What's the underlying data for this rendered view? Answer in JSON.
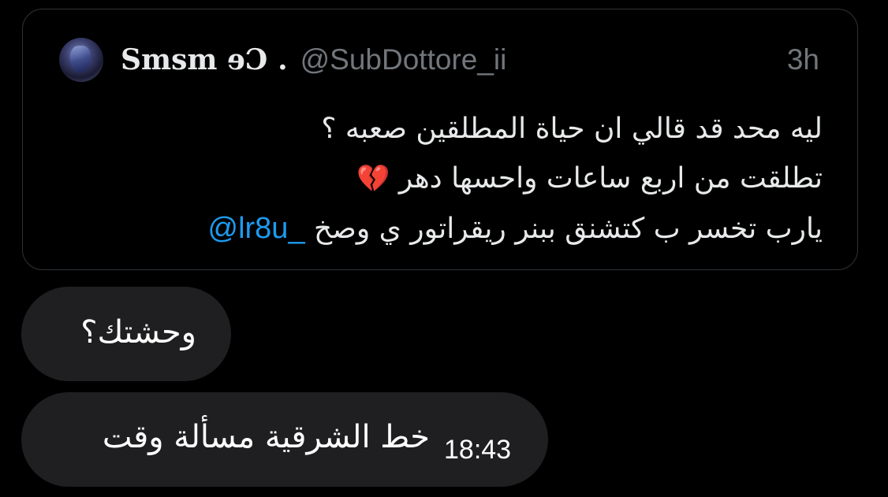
{
  "quoted_tweet": {
    "display_name": "Smsm ɘƆ .",
    "handle": "@SubDottore_ii",
    "time_ago": "3h",
    "lines": [
      "ليه محد قد قالي ان حياة المطلقين صعبه ؟",
      "تطلقت من اربع ساعات واحسها دهر"
    ],
    "line2_emoji": "💔",
    "line3_text": "يارب تخسر ب كتشنق ببنر ريقراتور ي وصخ",
    "line3_mention": "@lr8u_"
  },
  "messages": [
    {
      "text": "وحشتك؟"
    },
    {
      "text": "خط الشرقية مسألة وقت",
      "time": "18:43"
    }
  ],
  "colors": {
    "background": "#000000",
    "bubble": "#1f1f21",
    "card_border": "#2f3336",
    "secondary_text": "#71767b",
    "mention": "#1d9bf0"
  }
}
